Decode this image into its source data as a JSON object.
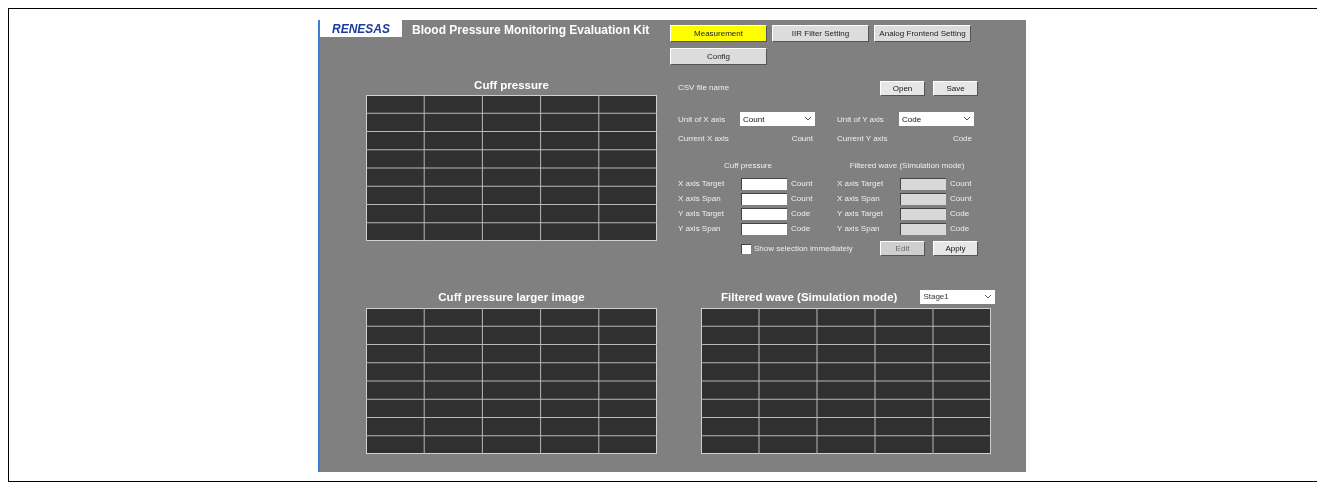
{
  "app": {
    "logo": "RENESAS",
    "title": "Blood Pressure Monitoring Evaluation Kit"
  },
  "tabs": [
    {
      "label": "Measurement",
      "selected": true
    },
    {
      "label": "IIR Filter Setting",
      "selected": false
    },
    {
      "label": "Analog Frontend Setting",
      "selected": false
    },
    {
      "label": "Config",
      "selected": false
    }
  ],
  "charts": [
    {
      "title": "Cuff pressure"
    },
    {
      "title": "Cuff pressure larger image"
    },
    {
      "title": "Filtered wave (Simulation mode)",
      "stage": "Stage1"
    }
  ],
  "csv": {
    "label": "CSV file name",
    "buttons": [
      "Open",
      "Save"
    ]
  },
  "units": [
    {
      "label": "Unit of X axis",
      "value": "Count",
      "current_label": "Current X axis",
      "current_value": "Count"
    },
    {
      "label": "Unit of Y axis",
      "value": "Code",
      "current_label": "Current Y axis",
      "current_value": "Code"
    }
  ],
  "ranges": [
    {
      "heading": "Cuff pressure",
      "disabled": false,
      "rows": [
        {
          "label": "X axis Target",
          "unit": "Count"
        },
        {
          "label": "X axis Span",
          "unit": "Count"
        },
        {
          "label": "Y axis Target",
          "unit": "Code"
        },
        {
          "label": "Y axis Span",
          "unit": "Code"
        }
      ]
    },
    {
      "heading": "Filtered wave (Simulation mode)",
      "disabled": true,
      "rows": [
        {
          "label": "X axis Target",
          "unit": "Count"
        },
        {
          "label": "X axis Span",
          "unit": "Count"
        },
        {
          "label": "Y axis Target",
          "unit": "Code"
        },
        {
          "label": "Y axis Span",
          "unit": "Code"
        }
      ]
    }
  ],
  "show_immediately": {
    "label": "Show selection immediately",
    "checked": false
  },
  "actions": [
    {
      "label": "Edit",
      "disabled": true
    },
    {
      "label": "Apply",
      "disabled": false
    }
  ]
}
